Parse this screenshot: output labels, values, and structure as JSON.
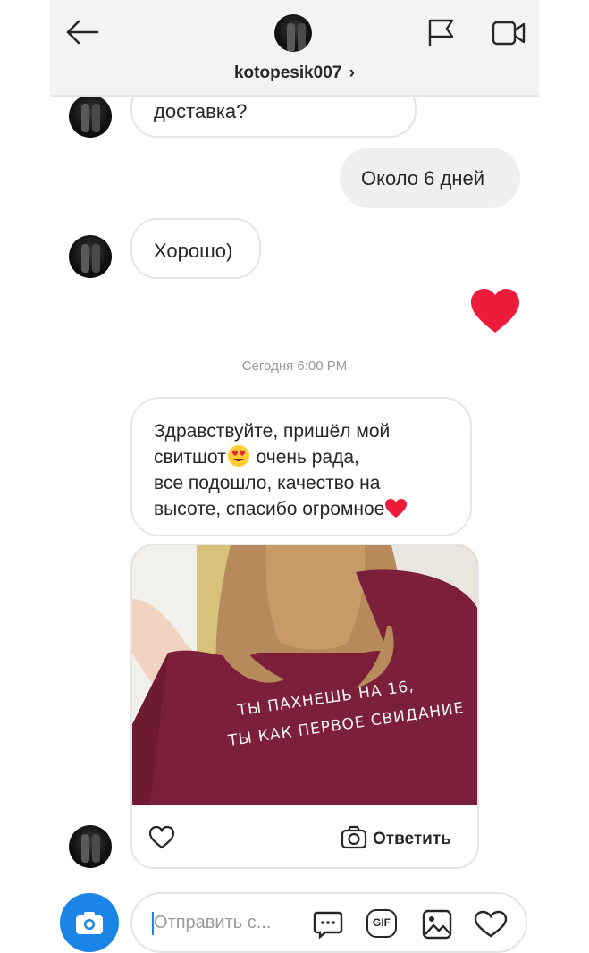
{
  "header": {
    "username": "kotopesik007",
    "chevron": "›",
    "icons": [
      "back-arrow-icon",
      "flag-icon",
      "video-call-icon"
    ]
  },
  "messages": {
    "incoming_1": "доставка?",
    "outgoing_1": "Около 6 дней",
    "incoming_2": "Хорошо)",
    "reaction": "heart",
    "timestamp": "Сегодня 6:00 PM",
    "incoming_3_lines": [
      "Здравствуйте, пришёл мой",
      "свитшот",
      " очень рада,",
      "все подошло, качество на",
      "высоте, спасибо огромное"
    ],
    "shirt_text_line1": "ТЫ ПАХНЕШЬ НА 16,",
    "shirt_text_line2": "ТЫ КАК ПЕРВОЕ СВИДАНИЕ",
    "reply_label": "Ответить"
  },
  "composer": {
    "placeholder": "Отправить с...",
    "gif_label": "GIF"
  },
  "colors": {
    "heart_red": "#ed1c3b",
    "camera_blue": "#1a85e6",
    "header_bg": "#f3f3f3",
    "bubble_out_bg": "#efefef",
    "shirt_maroon": "#7c1f3a"
  }
}
